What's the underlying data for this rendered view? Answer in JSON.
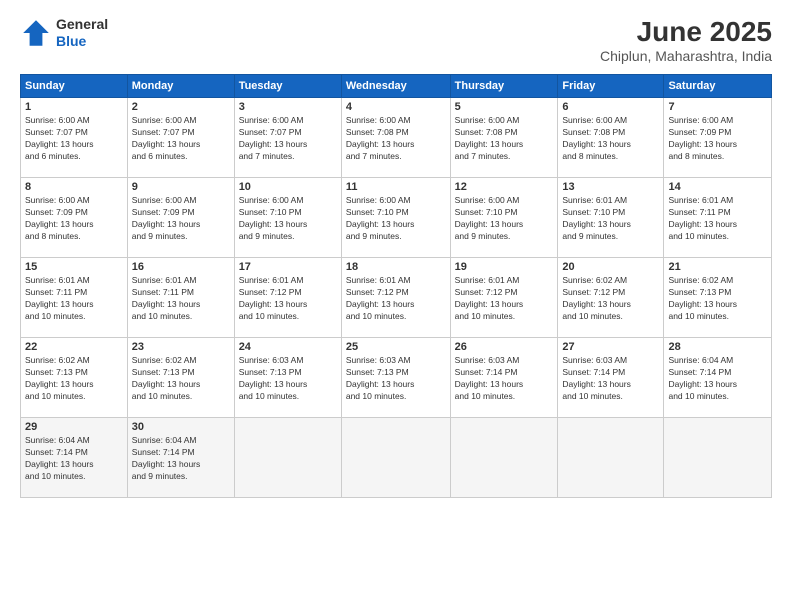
{
  "header": {
    "logo_general": "General",
    "logo_blue": "Blue",
    "title": "June 2025",
    "location": "Chiplun, Maharashtra, India"
  },
  "weekdays": [
    "Sunday",
    "Monday",
    "Tuesday",
    "Wednesday",
    "Thursday",
    "Friday",
    "Saturday"
  ],
  "weeks": [
    [
      {
        "day": "1",
        "detail": "Sunrise: 6:00 AM\nSunset: 7:07 PM\nDaylight: 13 hours\nand 6 minutes."
      },
      {
        "day": "2",
        "detail": "Sunrise: 6:00 AM\nSunset: 7:07 PM\nDaylight: 13 hours\nand 6 minutes."
      },
      {
        "day": "3",
        "detail": "Sunrise: 6:00 AM\nSunset: 7:07 PM\nDaylight: 13 hours\nand 7 minutes."
      },
      {
        "day": "4",
        "detail": "Sunrise: 6:00 AM\nSunset: 7:08 PM\nDaylight: 13 hours\nand 7 minutes."
      },
      {
        "day": "5",
        "detail": "Sunrise: 6:00 AM\nSunset: 7:08 PM\nDaylight: 13 hours\nand 7 minutes."
      },
      {
        "day": "6",
        "detail": "Sunrise: 6:00 AM\nSunset: 7:08 PM\nDaylight: 13 hours\nand 8 minutes."
      },
      {
        "day": "7",
        "detail": "Sunrise: 6:00 AM\nSunset: 7:09 PM\nDaylight: 13 hours\nand 8 minutes."
      }
    ],
    [
      {
        "day": "8",
        "detail": "Sunrise: 6:00 AM\nSunset: 7:09 PM\nDaylight: 13 hours\nand 8 minutes."
      },
      {
        "day": "9",
        "detail": "Sunrise: 6:00 AM\nSunset: 7:09 PM\nDaylight: 13 hours\nand 9 minutes."
      },
      {
        "day": "10",
        "detail": "Sunrise: 6:00 AM\nSunset: 7:10 PM\nDaylight: 13 hours\nand 9 minutes."
      },
      {
        "day": "11",
        "detail": "Sunrise: 6:00 AM\nSunset: 7:10 PM\nDaylight: 13 hours\nand 9 minutes."
      },
      {
        "day": "12",
        "detail": "Sunrise: 6:00 AM\nSunset: 7:10 PM\nDaylight: 13 hours\nand 9 minutes."
      },
      {
        "day": "13",
        "detail": "Sunrise: 6:01 AM\nSunset: 7:10 PM\nDaylight: 13 hours\nand 9 minutes."
      },
      {
        "day": "14",
        "detail": "Sunrise: 6:01 AM\nSunset: 7:11 PM\nDaylight: 13 hours\nand 10 minutes."
      }
    ],
    [
      {
        "day": "15",
        "detail": "Sunrise: 6:01 AM\nSunset: 7:11 PM\nDaylight: 13 hours\nand 10 minutes."
      },
      {
        "day": "16",
        "detail": "Sunrise: 6:01 AM\nSunset: 7:11 PM\nDaylight: 13 hours\nand 10 minutes."
      },
      {
        "day": "17",
        "detail": "Sunrise: 6:01 AM\nSunset: 7:12 PM\nDaylight: 13 hours\nand 10 minutes."
      },
      {
        "day": "18",
        "detail": "Sunrise: 6:01 AM\nSunset: 7:12 PM\nDaylight: 13 hours\nand 10 minutes."
      },
      {
        "day": "19",
        "detail": "Sunrise: 6:01 AM\nSunset: 7:12 PM\nDaylight: 13 hours\nand 10 minutes."
      },
      {
        "day": "20",
        "detail": "Sunrise: 6:02 AM\nSunset: 7:12 PM\nDaylight: 13 hours\nand 10 minutes."
      },
      {
        "day": "21",
        "detail": "Sunrise: 6:02 AM\nSunset: 7:13 PM\nDaylight: 13 hours\nand 10 minutes."
      }
    ],
    [
      {
        "day": "22",
        "detail": "Sunrise: 6:02 AM\nSunset: 7:13 PM\nDaylight: 13 hours\nand 10 minutes."
      },
      {
        "day": "23",
        "detail": "Sunrise: 6:02 AM\nSunset: 7:13 PM\nDaylight: 13 hours\nand 10 minutes."
      },
      {
        "day": "24",
        "detail": "Sunrise: 6:03 AM\nSunset: 7:13 PM\nDaylight: 13 hours\nand 10 minutes."
      },
      {
        "day": "25",
        "detail": "Sunrise: 6:03 AM\nSunset: 7:13 PM\nDaylight: 13 hours\nand 10 minutes."
      },
      {
        "day": "26",
        "detail": "Sunrise: 6:03 AM\nSunset: 7:14 PM\nDaylight: 13 hours\nand 10 minutes."
      },
      {
        "day": "27",
        "detail": "Sunrise: 6:03 AM\nSunset: 7:14 PM\nDaylight: 13 hours\nand 10 minutes."
      },
      {
        "day": "28",
        "detail": "Sunrise: 6:04 AM\nSunset: 7:14 PM\nDaylight: 13 hours\nand 10 minutes."
      }
    ],
    [
      {
        "day": "29",
        "detail": "Sunrise: 6:04 AM\nSunset: 7:14 PM\nDaylight: 13 hours\nand 10 minutes."
      },
      {
        "day": "30",
        "detail": "Sunrise: 6:04 AM\nSunset: 7:14 PM\nDaylight: 13 hours\nand 9 minutes."
      },
      {
        "day": "",
        "detail": ""
      },
      {
        "day": "",
        "detail": ""
      },
      {
        "day": "",
        "detail": ""
      },
      {
        "day": "",
        "detail": ""
      },
      {
        "day": "",
        "detail": ""
      }
    ]
  ]
}
